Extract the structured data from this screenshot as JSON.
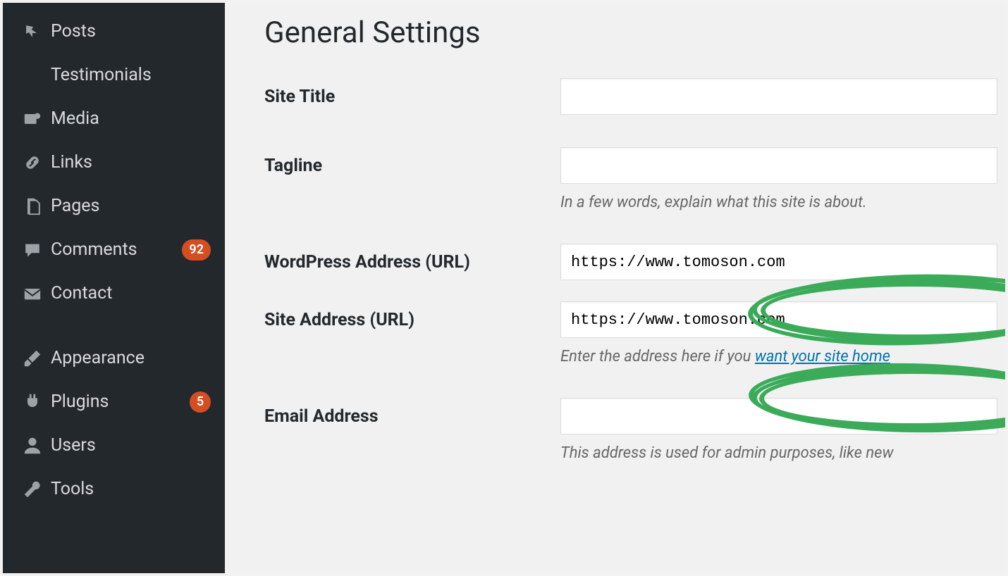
{
  "sidebar": {
    "items": [
      {
        "label": "Posts",
        "icon": "pin"
      },
      {
        "label": "Testimonials",
        "icon": ""
      },
      {
        "label": "Media",
        "icon": "media"
      },
      {
        "label": "Links",
        "icon": "link"
      },
      {
        "label": "Pages",
        "icon": "page"
      },
      {
        "label": "Comments",
        "icon": "comment",
        "badge": "92"
      },
      {
        "label": "Contact",
        "icon": "mail"
      },
      {
        "label": "Appearance",
        "icon": "brush"
      },
      {
        "label": "Plugins",
        "icon": "plug",
        "badge": "5"
      },
      {
        "label": "Users",
        "icon": "user"
      },
      {
        "label": "Tools",
        "icon": "tool"
      }
    ]
  },
  "page": {
    "title": "General Settings",
    "fields": {
      "site_title": {
        "label": "Site Title",
        "value": ""
      },
      "tagline": {
        "label": "Tagline",
        "value": "",
        "desc": "In a few words, explain what this site is about."
      },
      "wp_url": {
        "label": "WordPress Address (URL)",
        "value": "https://www.tomoson.com"
      },
      "site_url": {
        "label": "Site Address (URL)",
        "value": "https://www.tomoson.com",
        "desc_pre": "Enter the address here if you ",
        "desc_link": "want your site home"
      },
      "email": {
        "label": "Email Address",
        "value": "",
        "desc": "This address is used for admin purposes, like new"
      }
    }
  },
  "annotation": {
    "color": "#3bab5a"
  }
}
